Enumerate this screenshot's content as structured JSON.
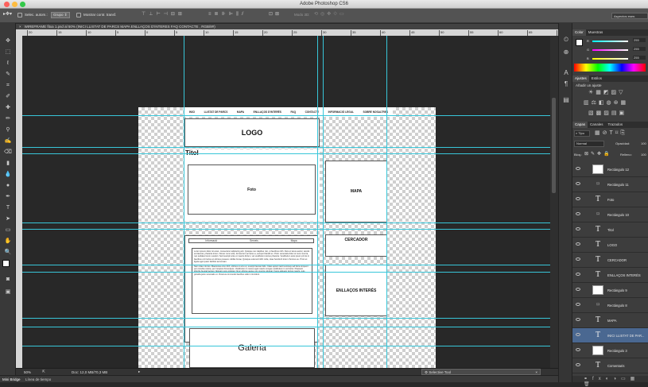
{
  "app": {
    "title": "Adobe Photoshop CS6",
    "workspace": "Aspectos esen."
  },
  "options_bar": {
    "auto_select_label": "Selec. autom.:",
    "auto_select_value": "Grupo",
    "show_transform_label": "Mostrar contr. transf.",
    "mode_3d_label": "Modo 3D:"
  },
  "document": {
    "tab_title": "WIREFRAME fitxa 1.psd al 50% (INICI  LLISTAT DE PARCS  MAPA ENLLAÇOS D'INTERES FAQ  CONTACTE  , RGB/8#)",
    "ruler_ticks": [
      "20",
      "15",
      "10",
      "5",
      "0",
      "5",
      "10",
      "15",
      "20",
      "25",
      "30",
      "35",
      "40",
      "45",
      "50",
      "55",
      "60",
      "65",
      "70"
    ]
  },
  "wireframe": {
    "nav": [
      "INICI",
      "LLISTAT DE PARCS",
      "MAPA",
      "ENLLAÇOS D'INTERÉS",
      "FAQ",
      "CONTACTE",
      "INFORMACIÓ LEGAL",
      "SOBRE NOSALTRES"
    ],
    "logo": "LOGO",
    "titol": "Titol",
    "foto": "Foto",
    "mapa": "MAPA",
    "tabs": [
      "Informació",
      "Serveis",
      "Mapa"
    ],
    "lorem1": "Lorem ipsum dolor sit amet, consectetur adipiscing elit. Quisque nec dapibus nisi, ut faucibus nibh. Duis et lacus auctor, iaculis est laoreet, pharetra lorem. Donec nunc ante, fermentum ac lacus a, semper blandit ex. Proin venenatis dolor at nunc viverra, nec sodales lorem suscipit. Sed suscipit ante et mauris dictum, vel vestibulum lectus pharetra. Vestibulum ante ipsum primis in faucibus orci luctus et ultrices posuere cubilia Curae; Quisque euismod nibh nulla, vitae hendrerit lorem rhoncus eu. Proin et ligula eget quam facilisis accumsan.",
    "lorem2": "Nam vitae nisi leo. Maecenas eros nibh, ultrices ut arcu et, suscipit laoreet felis. Class aptent taciti sociosqu ad litora torquent per conubia nostra, per inceptos himenaeos. Vestibulum in metus eget mauris congue vestibulum in vel tortor. Praesent lobortis feugiat laoreet. Aliquam erat volutpat. Nunc ultrices augue non viverra volutpat. Fusce aliquam lectus mauris, quis gravida justo venenatis ut. Vivamus commodo faucibus odio in tincidunt.",
    "cercador": "CERCADOR",
    "enllacos": "ENLLAÇOS INTERÉS",
    "galeria": "Galeria"
  },
  "status": {
    "zoom": "50%",
    "doc": "Doc: 12,0 MB/70,3 MB"
  },
  "floating": {
    "selective_tool": "Selective Tool"
  },
  "bottom_tabs": [
    "Mini Bridge",
    "Línea de tiempo"
  ],
  "panels": {
    "color_tabs": [
      "Color",
      "Muestras"
    ],
    "color_values": {
      "r": "255",
      "g": "255",
      "b": "255"
    },
    "color_letters": {
      "r": "R",
      "g": "G",
      "b": "B"
    },
    "adjust_tabs": [
      "Ajustes",
      "Estilos"
    ],
    "adjust_title": "Añadir un ajuste",
    "layers_tabs": [
      "Capas",
      "Canales",
      "Trazados"
    ],
    "filter_label": "Tipo",
    "blend_mode": "Normal",
    "opacity_label": "Opacidad:",
    "opacity_value": "100",
    "lock_label": "Bloq.:",
    "fill_label": "Relleno:",
    "fill_value": "100",
    "layers": [
      {
        "name": "Rectángulo 12",
        "kind": "rect",
        "selected": false
      },
      {
        "name": "Rectángulo 11",
        "kind": "dashed",
        "selected": false
      },
      {
        "name": "Foto",
        "kind": "text",
        "selected": false
      },
      {
        "name": "Rectángulo 10",
        "kind": "dashed",
        "selected": false
      },
      {
        "name": "Titol",
        "kind": "text",
        "selected": false
      },
      {
        "name": "LOGO",
        "kind": "text",
        "selected": false
      },
      {
        "name": "CERCADOR",
        "kind": "text",
        "selected": false
      },
      {
        "name": "ENLLAÇOS INTERÉS",
        "kind": "text",
        "selected": false
      },
      {
        "name": "Rectángulo 9",
        "kind": "rect",
        "selected": false
      },
      {
        "name": "Rectángulo 8",
        "kind": "dashed",
        "selected": false
      },
      {
        "name": "MAPA",
        "kind": "text",
        "selected": false
      },
      {
        "name": "INICI  LLISTAT DE PAR...",
        "kind": "text",
        "selected": true
      },
      {
        "name": "Rectángulo 3",
        "kind": "rect",
        "selected": false
      },
      {
        "name": "Comentaris",
        "kind": "text",
        "selected": false
      }
    ]
  },
  "colors": {
    "guide": "#38c6d9",
    "selected_layer": "#4a6891"
  }
}
